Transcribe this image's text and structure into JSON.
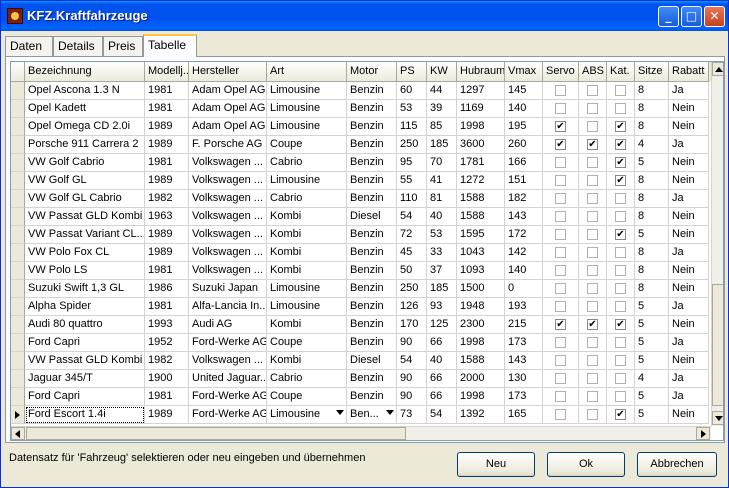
{
  "window": {
    "title": "KFZ.Kraftfahrzeuge",
    "minimize_glyph": "_",
    "maximize_glyph": "□",
    "close_glyph": "✕"
  },
  "tabs": [
    {
      "label": "Daten"
    },
    {
      "label": "Details"
    },
    {
      "label": "Preis"
    },
    {
      "label": "Tabelle",
      "active": true
    }
  ],
  "grid": {
    "columns": [
      "Bezeichnung",
      "Modellj...",
      "Hersteller",
      "Art",
      "Motor",
      "PS",
      "KW",
      "Hubraum",
      "Vmax",
      "Servo",
      "ABS",
      "Kat.",
      "Sitze",
      "Rabatt"
    ],
    "rows": [
      {
        "bez": "Opel Ascona 1.3 N",
        "mj": "1981",
        "her": "Adam Opel AG",
        "art": "Limousine",
        "mot": "Benzin",
        "ps": "60",
        "kw": "44",
        "hub": "1297",
        "vmax": "145",
        "servo": false,
        "abs": false,
        "kat": false,
        "sitze": "8",
        "rabatt": "Ja"
      },
      {
        "bez": "Opel Kadett",
        "mj": "1981",
        "her": "Adam Opel AG",
        "art": "Limousine",
        "mot": "Benzin",
        "ps": "53",
        "kw": "39",
        "hub": "1169",
        "vmax": "140",
        "servo": false,
        "abs": false,
        "kat": false,
        "sitze": "8",
        "rabatt": "Nein"
      },
      {
        "bez": "Opel Omega CD 2.0i",
        "mj": "1989",
        "her": "Adam Opel AG",
        "art": "Limousine",
        "mot": "Benzin",
        "ps": "115",
        "kw": "85",
        "hub": "1998",
        "vmax": "195",
        "servo": true,
        "abs": false,
        "kat": true,
        "sitze": "8",
        "rabatt": "Nein"
      },
      {
        "bez": "Porsche 911 Carrera 2",
        "mj": "1989",
        "her": "F. Porsche AG",
        "art": "Coupe",
        "mot": "Benzin",
        "ps": "250",
        "kw": "185",
        "hub": "3600",
        "vmax": "260",
        "servo": true,
        "abs": true,
        "kat": true,
        "sitze": "4",
        "rabatt": "Ja"
      },
      {
        "bez": "VW Golf Cabrio",
        "mj": "1981",
        "her": "Volkswagen ...",
        "art": "Cabrio",
        "mot": "Benzin",
        "ps": "95",
        "kw": "70",
        "hub": "1781",
        "vmax": "166",
        "servo": false,
        "abs": false,
        "kat": true,
        "sitze": "5",
        "rabatt": "Nein"
      },
      {
        "bez": "VW Golf GL",
        "mj": "1989",
        "her": "Volkswagen ...",
        "art": "Limousine",
        "mot": "Benzin",
        "ps": "55",
        "kw": "41",
        "hub": "1272",
        "vmax": "151",
        "servo": false,
        "abs": false,
        "kat": true,
        "sitze": "8",
        "rabatt": "Nein"
      },
      {
        "bez": "VW Golf GL Cabrio",
        "mj": "1982",
        "her": "Volkswagen ...",
        "art": "Cabrio",
        "mot": "Benzin",
        "ps": "110",
        "kw": "81",
        "hub": "1588",
        "vmax": "182",
        "servo": false,
        "abs": false,
        "kat": false,
        "sitze": "8",
        "rabatt": "Ja"
      },
      {
        "bez": "VW Passat GLD Kombi",
        "mj": "1963",
        "her": "Volkswagen ...",
        "art": "Kombi",
        "mot": "Diesel",
        "ps": "54",
        "kw": "40",
        "hub": "1588",
        "vmax": "143",
        "servo": false,
        "abs": false,
        "kat": false,
        "sitze": "8",
        "rabatt": "Nein"
      },
      {
        "bez": "VW Passat Variant CL...",
        "mj": "1989",
        "her": "Volkswagen ...",
        "art": "Kombi",
        "mot": "Benzin",
        "ps": "72",
        "kw": "53",
        "hub": "1595",
        "vmax": "172",
        "servo": false,
        "abs": false,
        "kat": true,
        "sitze": "5",
        "rabatt": "Nein"
      },
      {
        "bez": "VW Polo Fox CL",
        "mj": "1989",
        "her": "Volkswagen ...",
        "art": "Kombi",
        "mot": "Benzin",
        "ps": "45",
        "kw": "33",
        "hub": "1043",
        "vmax": "142",
        "servo": false,
        "abs": false,
        "kat": false,
        "sitze": "8",
        "rabatt": "Ja"
      },
      {
        "bez": "VW Polo LS",
        "mj": "1981",
        "her": "Volkswagen ...",
        "art": "Kombi",
        "mot": "Benzin",
        "ps": "50",
        "kw": "37",
        "hub": "1093",
        "vmax": "140",
        "servo": false,
        "abs": false,
        "kat": false,
        "sitze": "8",
        "rabatt": "Nein"
      },
      {
        "bez": "Suzuki Swift 1,3 GL",
        "mj": "1986",
        "her": "Suzuki Japan",
        "art": "Limousine",
        "mot": "Benzin",
        "ps": "250",
        "kw": "185",
        "hub": "1500",
        "vmax": "0",
        "servo": false,
        "abs": false,
        "kat": false,
        "sitze": "8",
        "rabatt": "Nein"
      },
      {
        "bez": "Alpha Spider",
        "mj": "1981",
        "her": "Alfa-Lancia In...",
        "art": "Limousine",
        "mot": "Benzin",
        "ps": "126",
        "kw": "93",
        "hub": "1948",
        "vmax": "193",
        "servo": false,
        "abs": false,
        "kat": false,
        "sitze": "5",
        "rabatt": "Ja"
      },
      {
        "bez": "Audi 80 quattro",
        "mj": "1993",
        "her": "Audi AG",
        "art": "Kombi",
        "mot": "Benzin",
        "ps": "170",
        "kw": "125",
        "hub": "2300",
        "vmax": "215",
        "servo": true,
        "abs": true,
        "kat": true,
        "sitze": "5",
        "rabatt": "Nein"
      },
      {
        "bez": "Ford Capri",
        "mj": "1952",
        "her": "Ford-Werke AG",
        "art": "Coupe",
        "mot": "Benzin",
        "ps": "90",
        "kw": "66",
        "hub": "1998",
        "vmax": "173",
        "servo": false,
        "abs": false,
        "kat": false,
        "sitze": "5",
        "rabatt": "Ja"
      },
      {
        "bez": "VW Passat GLD Kombi",
        "mj": "1982",
        "her": "Volkswagen ...",
        "art": "Kombi",
        "mot": "Diesel",
        "ps": "54",
        "kw": "40",
        "hub": "1588",
        "vmax": "143",
        "servo": false,
        "abs": false,
        "kat": false,
        "sitze": "5",
        "rabatt": "Nein"
      },
      {
        "bez": "Jaguar 345/T",
        "mj": "1900",
        "her": "United Jaguar...",
        "art": "Cabrio",
        "mot": "Benzin",
        "ps": "90",
        "kw": "66",
        "hub": "2000",
        "vmax": "130",
        "servo": false,
        "abs": false,
        "kat": false,
        "sitze": "4",
        "rabatt": "Ja"
      },
      {
        "bez": "Ford Capri",
        "mj": "1981",
        "her": "Ford-Werke AG",
        "art": "Coupe",
        "mot": "Benzin",
        "ps": "90",
        "kw": "66",
        "hub": "1998",
        "vmax": "173",
        "servo": false,
        "abs": false,
        "kat": false,
        "sitze": "5",
        "rabatt": "Ja"
      },
      {
        "bez": "Ford Escort 1.4i",
        "mj": "1989",
        "her": "Ford-Werke AG",
        "art": "Limousine",
        "mot": "Ben...",
        "ps": "73",
        "kw": "54",
        "hub": "1392",
        "vmax": "165",
        "servo": false,
        "abs": false,
        "kat": true,
        "sitze": "5",
        "rabatt": "Nein",
        "current": true
      }
    ]
  },
  "status": {
    "text": "Datensatz für 'Fahrzeug' selektieren oder neu eingeben und übernehmen"
  },
  "buttons": {
    "neu": "Neu",
    "ok": "Ok",
    "abbrechen": "Abbrechen"
  },
  "colors": {
    "title_bar": "#0053ee",
    "row_alt": "#fefbe6",
    "active_tab_accent": "#ffc83c"
  }
}
